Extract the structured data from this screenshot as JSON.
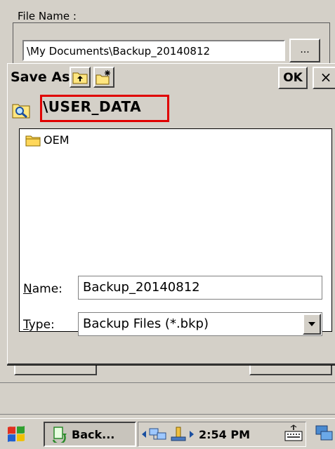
{
  "background_window": {
    "group_label": "File Name :",
    "path_value": "\\My Documents\\Backup_20140812",
    "browse_label": "..."
  },
  "dialog": {
    "title": "Save As",
    "ok_label": "OK",
    "close_label": "×",
    "location": "\\USER_DATA",
    "items": [
      {
        "name": "OEM",
        "icon": "folder-icon"
      }
    ],
    "name_label_accel": "N",
    "name_label_rest": "ame:",
    "name_value": "Backup_20140812",
    "type_label_accel": "T",
    "type_label_rest": "ype:",
    "type_value": "Backup Files (*.bkp)"
  },
  "taskbar": {
    "task_label": "Back...",
    "clock": "2:54 PM"
  },
  "colors": {
    "highlight": "#e00000",
    "window": "#d4d0c8"
  }
}
